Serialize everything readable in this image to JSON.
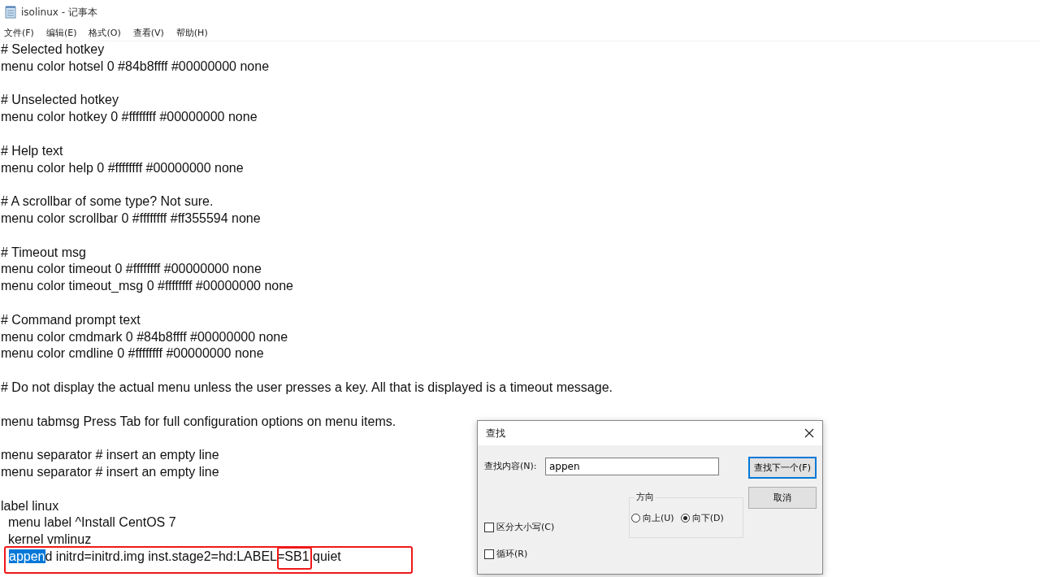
{
  "window": {
    "title": "isolinux - 记事本"
  },
  "menu": [
    "文件(F)",
    "编辑(E)",
    "格式(O)",
    "查看(V)",
    "帮助(H)"
  ],
  "blocks": [
    [
      {
        "text": "# Selected hotkey"
      },
      {
        "text": "menu color hotsel 0 #84b8ffff #00000000 none"
      }
    ],
    [
      {
        "text": "# Unselected hotkey"
      },
      {
        "text": "menu color hotkey 0 #ffffffff #00000000 none"
      }
    ],
    [
      {
        "text": "# Help text"
      },
      {
        "text": "menu color help 0 #ffffffff #00000000 none"
      }
    ],
    [
      {
        "text": "# A scrollbar of some type? Not sure."
      },
      {
        "text": "menu color scrollbar 0 #ffffffff #ff355594 none"
      }
    ],
    [
      {
        "text": "# Timeout msg"
      },
      {
        "text": "menu color timeout 0 #ffffffff #00000000 none"
      },
      {
        "text": "menu color timeout_msg 0 #ffffffff #00000000 none"
      }
    ],
    [
      {
        "text": "# Command prompt text"
      },
      {
        "text": "menu color cmdmark 0 #84b8ffff #00000000 none"
      },
      {
        "text": "menu color cmdline 0 #ffffffff #00000000 none"
      }
    ],
    [
      {
        "text": "# Do not display the actual menu unless the user presses a key. All that is displayed is a timeout message."
      }
    ],
    [
      {
        "text": "menu tabmsg Press Tab for full configuration options on menu items."
      }
    ],
    [
      {
        "text": "menu separator # insert an empty line"
      },
      {
        "text": "menu separator # insert an empty line"
      }
    ],
    [
      {
        "text": "label linux"
      },
      {
        "text": "  menu label ^Install CentOS 7"
      },
      {
        "text": "  kernel vmlinuz"
      },
      {
        "selection": "appen",
        "text": "d initrd=initrd.img inst.stage2=hd:LABEL=SB1 quiet",
        "marked": true
      }
    ]
  ],
  "find_dialog": {
    "title": "查找",
    "find_label": "查找内容(N):",
    "find_value": "appen",
    "buttons": [
      {
        "label": "查找下一个(F)",
        "default": true
      },
      {
        "label": "取消",
        "default": false
      }
    ],
    "direction": {
      "label": "方向",
      "options": [
        {
          "label": "向上(U)",
          "selected": false
        },
        {
          "label": "向下(D)",
          "selected": true
        }
      ]
    },
    "checkboxes": [
      {
        "label": "区分大小写(C)",
        "checked": false
      },
      {
        "label": "循环(R)",
        "checked": false
      }
    ]
  }
}
